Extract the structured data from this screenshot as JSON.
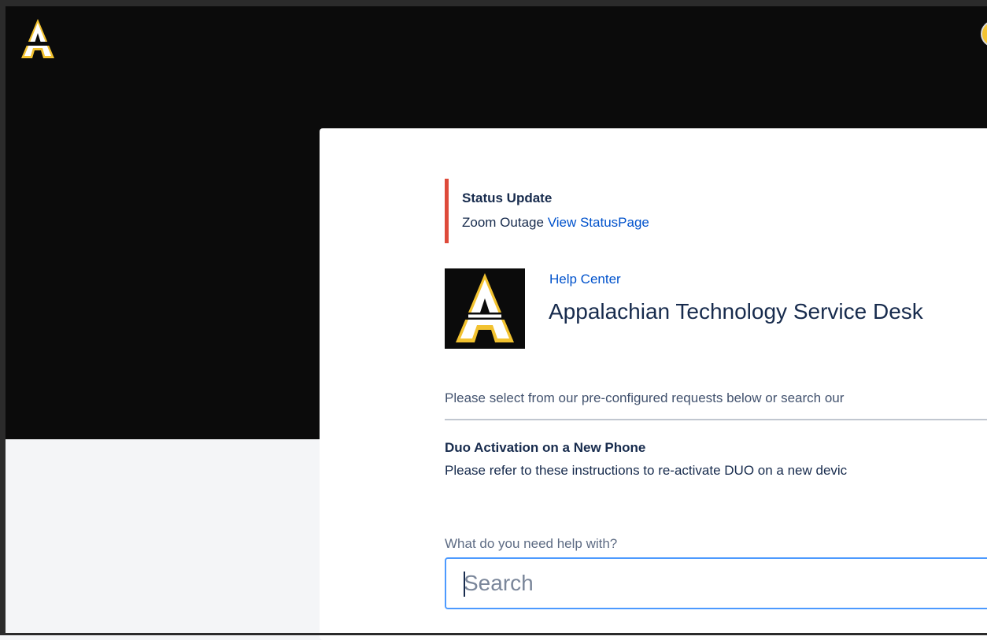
{
  "header": {
    "logo": "appalachian-a-logo",
    "avatar": "user-avatar"
  },
  "status": {
    "title": "Status Update",
    "message": "Zoom Outage",
    "link": "View StatusPage",
    "accent_color": "#de4a3a"
  },
  "portal": {
    "logo": "appalachian-a-logo",
    "help_center": "Help Center",
    "title": "Appalachian Technology Service Desk",
    "intro": "Please select from our pre-configured requests below or search our"
  },
  "request": {
    "title": "Duo Activation on a New Phone",
    "description": "Please refer to these instructions to re-activate DUO on a new devic"
  },
  "search": {
    "label": "What do you need help with?",
    "placeholder": "Search",
    "focus_color": "#4c9aff"
  },
  "colors": {
    "header_bg": "#0b0b0b",
    "brand_gold": "#f2c230",
    "link": "#0052cc"
  }
}
